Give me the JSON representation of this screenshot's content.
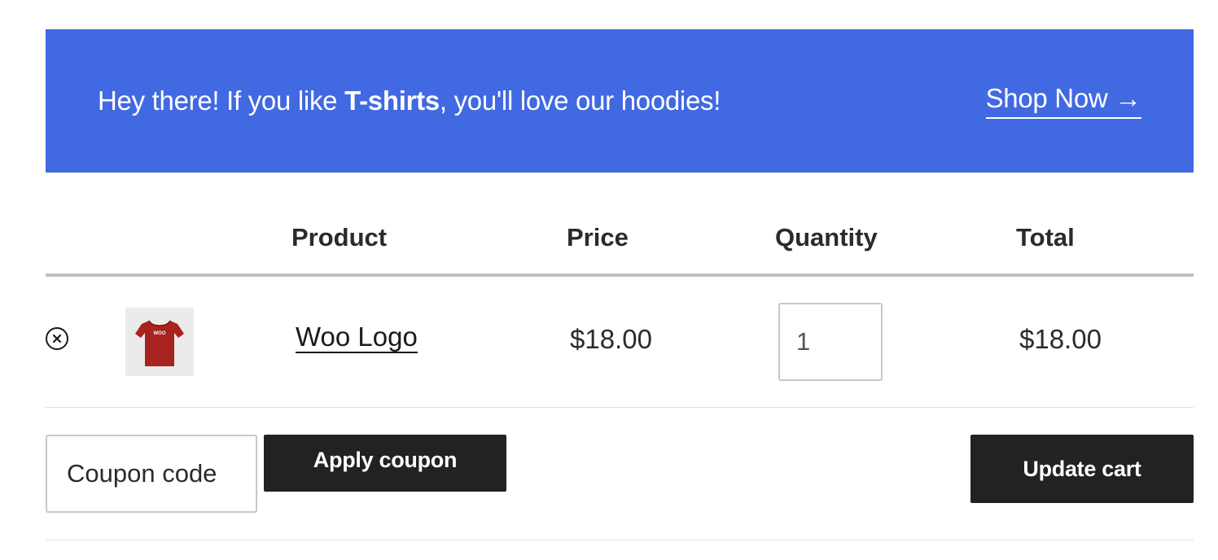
{
  "banner": {
    "text_before": "Hey there! If you like ",
    "text_bold": "T-shirts",
    "text_after": ", you'll love our hoodies!",
    "cta_label": "Shop Now →",
    "background_color": "#4169e1"
  },
  "cart_table": {
    "headers": {
      "product": "Product",
      "price": "Price",
      "quantity": "Quantity",
      "total": "Total"
    },
    "items": [
      {
        "remove_icon": "remove-circle-x-icon",
        "thumbnail_icon": "red-tshirt-thumbnail",
        "thumbnail_text": "WOO",
        "product_name": "Woo Logo",
        "price": "$18.00",
        "quantity": "1",
        "total": "$18.00"
      }
    ]
  },
  "actions": {
    "coupon_placeholder": "Coupon code",
    "apply_coupon_label": "Apply coupon",
    "update_cart_label": "Update cart"
  }
}
